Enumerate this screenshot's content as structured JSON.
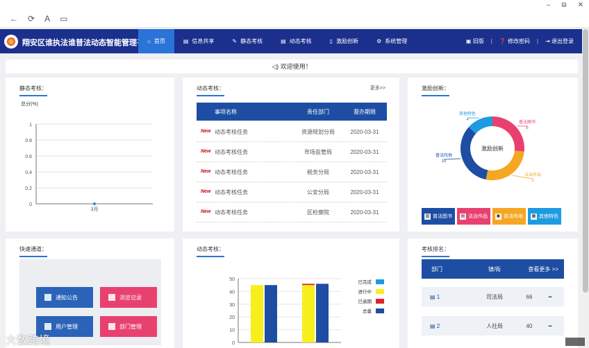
{
  "browser": {
    "back_icon": "←",
    "reload_icon": "⟳",
    "reader_label": "A",
    "tabs_icon": "▭",
    "minimize": "–",
    "restore": "⧉",
    "close": "✕"
  },
  "header": {
    "title": "翔安区谁执法谁普法动态智能管理平台",
    "nav": [
      {
        "label": "首页",
        "icon": "⌂"
      },
      {
        "label": "信息共享",
        "icon": "▤"
      },
      {
        "label": "静态考核",
        "icon": "✎"
      },
      {
        "label": "动态考核",
        "icon": "▤"
      },
      {
        "label": "激励创新",
        "icon": "▯"
      },
      {
        "label": "系统管理",
        "icon": "⚙"
      }
    ],
    "links": [
      {
        "label": "旧版",
        "icon": "▣"
      },
      {
        "label": "修改密码",
        "icon": "❓"
      },
      {
        "label": "退出登录",
        "icon": "⇥"
      }
    ]
  },
  "welcome": {
    "icon": "◁)",
    "text": "欢迎使用！"
  },
  "static_panel": {
    "title": "静态考核：",
    "chart_data": {
      "type": "line",
      "ylabel": "总分(%)",
      "categories": [
        "3月"
      ],
      "values": [
        0
      ],
      "yticks": [
        "0",
        "0.2",
        "0.4",
        "0.6",
        "0.8",
        "1"
      ],
      "ylim": [
        0,
        1
      ]
    }
  },
  "dynamic_panel": {
    "title": "动态考核：",
    "more": "更多>>",
    "columns": [
      "事项名称",
      "责任部门",
      "督办期限"
    ],
    "rows": [
      {
        "mark": "New",
        "name": "动态考核任务",
        "dept": "资源规划分局",
        "date": "2020-03-31"
      },
      {
        "mark": "New",
        "name": "动态考核任务",
        "dept": "市场监管局",
        "date": "2020-03-31"
      },
      {
        "mark": "New",
        "name": "动态考核任务",
        "dept": "税务分局",
        "date": "2020-03-31"
      },
      {
        "mark": "New",
        "name": "动态考核任务",
        "dept": "公安分局",
        "date": "2020-03-31"
      },
      {
        "mark": "New",
        "name": "动态考核任务",
        "dept": "区检察院",
        "date": "2020-03-31"
      }
    ]
  },
  "incentive_panel": {
    "title": "激励创新：",
    "center": "激励创新",
    "chart_data": {
      "type": "pie",
      "categories": [
        "普法图书",
        "法治作品",
        "普法阵地",
        "其他特色"
      ],
      "values": [
        8,
        8,
        10,
        4
      ],
      "colors": [
        "#e8416f",
        "#f5a623",
        "#1d4ea3",
        "#1e9be0"
      ]
    },
    "buttons": [
      {
        "label": "普法图书",
        "icon": "▥",
        "color": "#1d4ea3"
      },
      {
        "label": "法治作品",
        "icon": "▤",
        "color": "#e8416f"
      },
      {
        "label": "普法阵地",
        "icon": "▣",
        "color": "#f5a623"
      },
      {
        "label": "其他特色",
        "icon": "▦",
        "color": "#1e9be0"
      }
    ]
  },
  "quick_panel": {
    "title": "快速通道：",
    "buttons": [
      {
        "label": "通知公告",
        "color": "#2a63b8"
      },
      {
        "label": "浏览记录",
        "color": "#e8416f"
      },
      {
        "label": "用户管理",
        "color": "#2a63b8"
      },
      {
        "label": "部门管理",
        "color": "#e8416f"
      }
    ]
  },
  "dynamic_chart_panel": {
    "title": "动态考核：",
    "chart_data": {
      "type": "bar",
      "categories": [
        "",
        ""
      ],
      "series": [
        {
          "name": "已完成",
          "color": "#1e9be0",
          "values": [
            0,
            0
          ]
        },
        {
          "name": "进行中",
          "color": "#f7ef1b",
          "values": [
            45,
            45
          ]
        },
        {
          "name": "已逾期",
          "color": "#e0242b",
          "values": [
            0,
            1
          ]
        },
        {
          "name": "总量",
          "color": "#1d4ea3",
          "values": [
            45,
            46
          ]
        }
      ],
      "yticks": [
        "0",
        "10",
        "20",
        "30",
        "40",
        "50"
      ],
      "ylim": [
        0,
        50
      ]
    }
  },
  "ranking_panel": {
    "title": "考核排名：",
    "columns": [
      "部门",
      "镇/街",
      "查看更多 >>"
    ],
    "rows": [
      {
        "rank": "1",
        "name": "司法局",
        "score": "66",
        "trend": "━"
      },
      {
        "rank": "2",
        "name": "人社局",
        "score": "40",
        "trend": "━"
      }
    ]
  },
  "watermark": "大数跨境"
}
